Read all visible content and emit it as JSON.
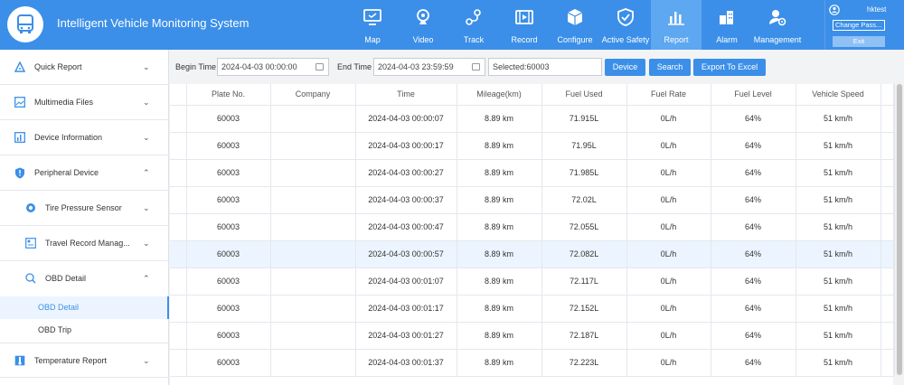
{
  "header": {
    "title": "Intelligent Vehicle Monitoring System",
    "nav": [
      {
        "label": "Map",
        "icon": "monitor-icon"
      },
      {
        "label": "Video",
        "icon": "camera-icon"
      },
      {
        "label": "Track",
        "icon": "track-icon"
      },
      {
        "label": "Record",
        "icon": "film-icon"
      },
      {
        "label": "Configure",
        "icon": "cube-icon"
      },
      {
        "label": "Active Safety",
        "icon": "shield-check-icon"
      },
      {
        "label": "Report",
        "icon": "bar-chart-icon"
      },
      {
        "label": "Alarm",
        "icon": "alarm-building-icon"
      },
      {
        "label": "Management",
        "icon": "user-gear-icon"
      }
    ],
    "active_nav": "Report",
    "user": {
      "name": "hktest",
      "change_pass": "Change Pass...",
      "exit": "Exit"
    }
  },
  "sidebar": {
    "items": [
      {
        "label": "Quick Report",
        "chevron": "⌄"
      },
      {
        "label": "Multimedia Files",
        "chevron": "⌄"
      },
      {
        "label": "Device Information",
        "chevron": "⌄"
      },
      {
        "label": "Peripheral Device",
        "chevron": "⌃"
      },
      {
        "label": "Tire Pressure Sensor",
        "chevron": "⌄"
      },
      {
        "label": "Travel Record Manag...",
        "chevron": "⌄"
      },
      {
        "label": "OBD Detail",
        "chevron": "⌃"
      },
      {
        "label": "OBD Detail"
      },
      {
        "label": "OBD Trip"
      },
      {
        "label": "Temperature Report",
        "chevron": "⌄"
      }
    ]
  },
  "toolbar": {
    "begin_label": "Begin Time",
    "begin_value": "2024-04-03 00:00:00",
    "end_label": "End Time",
    "end_value": "2024-04-03 23:59:59",
    "selected_value": "Selected:60003",
    "device_btn": "Device",
    "search_btn": "Search",
    "export_btn": "Export To Excel"
  },
  "table": {
    "columns": [
      "",
      "Plate No.",
      "Company",
      "Time",
      "Mileage(km)",
      "Fuel Used",
      "Fuel Rate",
      "Fuel Level",
      "Vehicle Speed",
      ""
    ],
    "rows": [
      [
        "60003",
        "",
        "2024-04-03 00:00:07",
        "8.89 km",
        "71.915L",
        "0L/h",
        "64%",
        "51 km/h"
      ],
      [
        "60003",
        "",
        "2024-04-03 00:00:17",
        "8.89 km",
        "71.95L",
        "0L/h",
        "64%",
        "51 km/h"
      ],
      [
        "60003",
        "",
        "2024-04-03 00:00:27",
        "8.89 km",
        "71.985L",
        "0L/h",
        "64%",
        "51 km/h"
      ],
      [
        "60003",
        "",
        "2024-04-03 00:00:37",
        "8.89 km",
        "72.02L",
        "0L/h",
        "64%",
        "51 km/h"
      ],
      [
        "60003",
        "",
        "2024-04-03 00:00:47",
        "8.89 km",
        "72.055L",
        "0L/h",
        "64%",
        "51 km/h"
      ],
      [
        "60003",
        "",
        "2024-04-03 00:00:57",
        "8.89 km",
        "72.082L",
        "0L/h",
        "64%",
        "51 km/h"
      ],
      [
        "60003",
        "",
        "2024-04-03 00:01:07",
        "8.89 km",
        "72.117L",
        "0L/h",
        "64%",
        "51 km/h"
      ],
      [
        "60003",
        "",
        "2024-04-03 00:01:17",
        "8.89 km",
        "72.152L",
        "0L/h",
        "64%",
        "51 km/h"
      ],
      [
        "60003",
        "",
        "2024-04-03 00:01:27",
        "8.89 km",
        "72.187L",
        "0L/h",
        "64%",
        "51 km/h"
      ],
      [
        "60003",
        "",
        "2024-04-03 00:01:37",
        "8.89 km",
        "72.223L",
        "0L/h",
        "64%",
        "51 km/h"
      ]
    ],
    "highlighted_row": 5
  },
  "colors": {
    "primary": "#3b8fe8",
    "active_nav": "#5ea7f1",
    "highlight_row": "#ecf5ff"
  }
}
